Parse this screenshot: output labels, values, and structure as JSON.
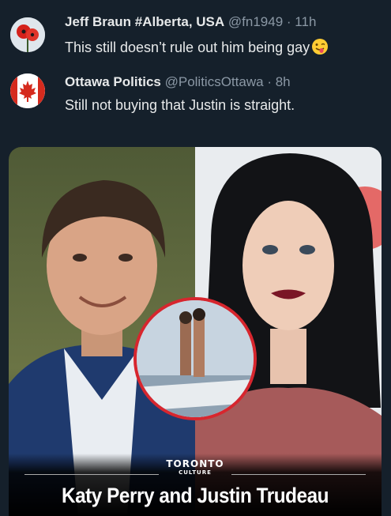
{
  "tweets": [
    {
      "name": "Jeff Braun #Alberta, USA",
      "handle": "@fn1949",
      "time": "· 11h",
      "text": "This still doesn’t rule out him being gay",
      "emoji": "winking-face-with-tongue",
      "avatar": "red-poppy-flowers"
    },
    {
      "name": "Ottawa Politics",
      "handle": "@PoliticsOttawa",
      "time": "· 8h",
      "text": "Still not buying that Justin is straight.",
      "avatar": "canadian-flag-maple-leaf"
    }
  ],
  "media": {
    "logo_top": "TORONTO",
    "logo_bottom": "CULTURE",
    "headline": "Katy Perry and Justin Trudeau",
    "colors": {
      "inset_ring": "#d7262e",
      "background": "#15202b"
    }
  }
}
